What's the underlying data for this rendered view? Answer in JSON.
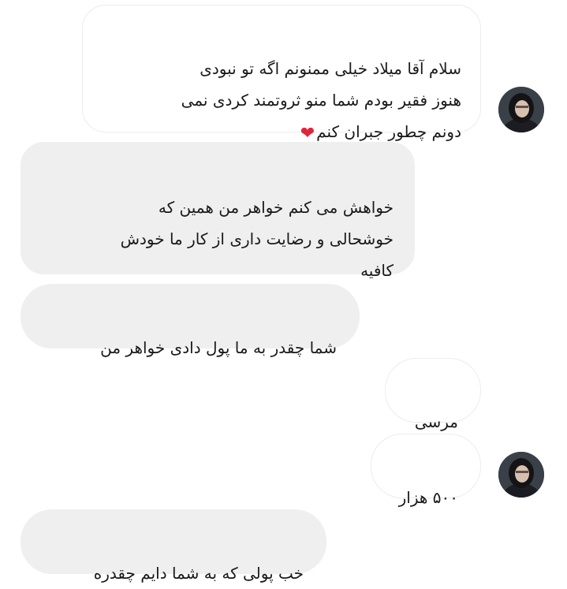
{
  "messages": [
    {
      "text": "سلام آقا میلاد خیلی ممنونم اگه تو نبودی\nهنوز فقیر بودم شما منو ثروتمند کردی نمی\nدونم چطور جبران کنم",
      "emoji": "❤"
    },
    {
      "text": "خواهش می کنم خواهر من همین که\nخوشحالی و رضایت داری از کار ما خودش\nکافیه"
    },
    {
      "text": "شما چقدر به ما پول دادی خواهر من"
    },
    {
      "text": "مرسی"
    },
    {
      "text": "۵۰۰ هزار"
    },
    {
      "text": "خب پولی که به شما دایم چقدره"
    }
  ],
  "colors": {
    "outgoing_bg": "#efefef",
    "incoming_border": "#ececec",
    "heart": "#e0243a"
  },
  "icons": [
    "avatar",
    "red-heart-icon"
  ]
}
